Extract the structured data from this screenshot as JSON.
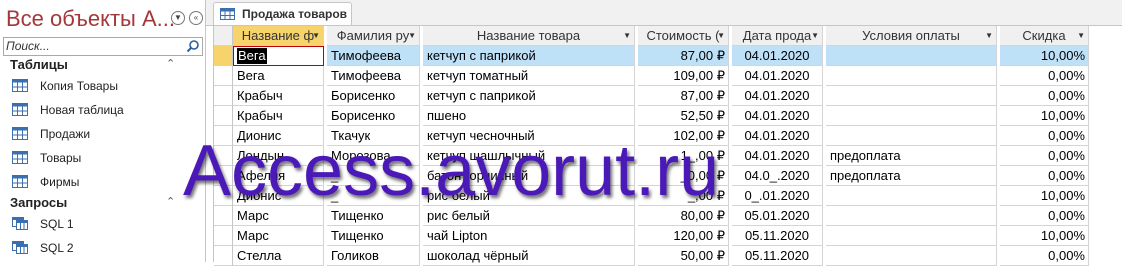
{
  "nav": {
    "title": "Все объекты A...",
    "search_placeholder": "Поиск...",
    "groups": [
      {
        "label": "Таблицы",
        "items": [
          {
            "label": "Копия Товары",
            "icon": "table-icon"
          },
          {
            "label": "Новая таблица",
            "icon": "table-icon"
          },
          {
            "label": "Продажи",
            "icon": "table-icon"
          },
          {
            "label": "Товары",
            "icon": "table-icon"
          },
          {
            "label": "Фирмы",
            "icon": "table-icon"
          }
        ]
      },
      {
        "label": "Запросы",
        "items": [
          {
            "label": "SQL 1",
            "icon": "query-icon"
          },
          {
            "label": "SQL 2",
            "icon": "query-icon"
          }
        ]
      }
    ]
  },
  "tab": {
    "label": "Продажа товаров",
    "icon": "table-icon"
  },
  "grid": {
    "columns": [
      "Название ф",
      "Фамилия ру",
      "Название товара",
      "Стоимость (",
      "Дата прода",
      "Условия оплаты",
      "Скидка"
    ],
    "rows": [
      [
        "Вега",
        "Тимофеева",
        "кетчуп с паприкой",
        "87,00 ₽",
        "04.01.2020",
        "",
        "10,00%"
      ],
      [
        "Вега",
        "Тимофеева",
        "кетчуп томатный",
        "109,00 ₽",
        "04.01.2020",
        "",
        "0,00%"
      ],
      [
        "Крабыч",
        "Борисенко",
        "кетчуп с паприкой",
        "87,00 ₽",
        "04.01.2020",
        "",
        "0,00%"
      ],
      [
        "Крабыч",
        "Борисенко",
        "пшено",
        "52,50 ₽",
        "04.01.2020",
        "",
        "10,00%"
      ],
      [
        "Дионис",
        "Ткачук",
        "кетчуп чесночный",
        "102,00 ₽",
        "04.01.2020",
        "",
        "0,00%"
      ],
      [
        "Лондын",
        "Морозова",
        "кетчуп шашлычный",
        "1_,00 ₽",
        "04.01.2020",
        "предоплата",
        "0,00%"
      ],
      [
        "Афелия",
        "_",
        "батон горчичный",
        "_0,00 ₽",
        "04.0_.2020",
        "предоплата",
        "0,00%"
      ],
      [
        "Дионис",
        "_",
        "рис белый",
        "_,00 ₽",
        "0_.01.2020",
        "",
        "10,00%"
      ],
      [
        "Марс",
        "Тищенко",
        "рис белый",
        "80,00 ₽",
        "05.01.2020",
        "",
        "0,00%"
      ],
      [
        "Марс",
        "Тищенко",
        "чай Lipton",
        "120,00 ₽",
        "05.11.2020",
        "",
        "10,00%"
      ],
      [
        "Стелла",
        "Голиков",
        "шоколад чёрный",
        "50,00 ₽",
        "05.11.2020",
        "",
        "0,00%"
      ]
    ]
  },
  "watermark": "Access.avorut.ru",
  "colors": {
    "nav_title": "#a4373a",
    "selected_row": "#bfe1f7",
    "sort_header": "#f7d36b",
    "watermark": "#4a19b8"
  }
}
